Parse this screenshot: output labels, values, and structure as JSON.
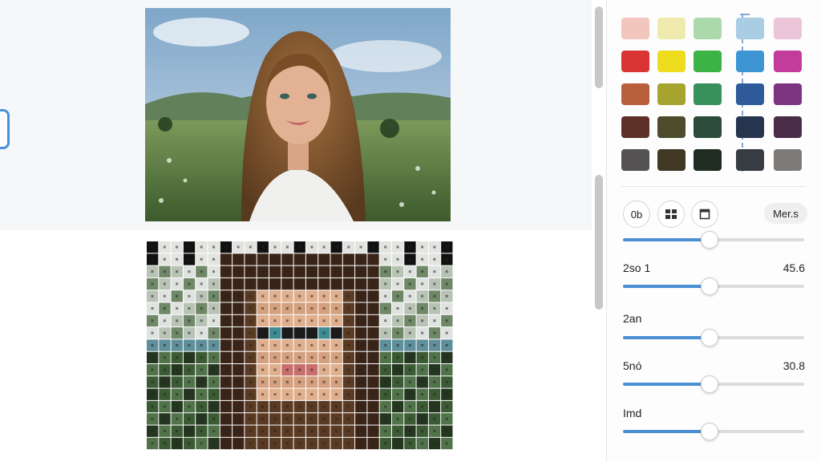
{
  "palette": {
    "rows": [
      [
        "#f3c6bd",
        "#efebaf",
        "#acd9ac",
        "#a9cde3",
        "#ecc6d8"
      ],
      [
        "#da3434",
        "#eedc1e",
        "#3db245",
        "#3d95d3",
        "#c43c9b"
      ],
      [
        "#b95f3c",
        "#a6a42f",
        "#38905a",
        "#2e5a9a",
        "#7c3480"
      ],
      [
        "#5e3128",
        "#4c4b2c",
        "#2c4c39",
        "#27344e",
        "#4a2c46"
      ],
      [
        "#545252",
        "#3e3824",
        "#1f2e21",
        "#373b42",
        "#7d7a77"
      ]
    ]
  },
  "toolbar": {
    "ob_label": "0b",
    "grid_icon": "grid-icon",
    "save_icon": "image-frame-icon",
    "more_label": "Mer.s"
  },
  "sliders": [
    {
      "label": "",
      "value_text": "",
      "level": 0.48
    },
    {
      "label": "2so 1",
      "value_text": "45.6",
      "level": 0.48
    },
    {
      "label": "2an",
      "value_text": "",
      "level": 0.48
    },
    {
      "label": "5nó",
      "value_text": "30.8",
      "level": 0.48
    },
    {
      "label": "Imd",
      "value_text": "",
      "level": 0.48
    }
  ],
  "colors": {
    "accent": "#4a8fd4",
    "handle": "#4a90d9"
  }
}
